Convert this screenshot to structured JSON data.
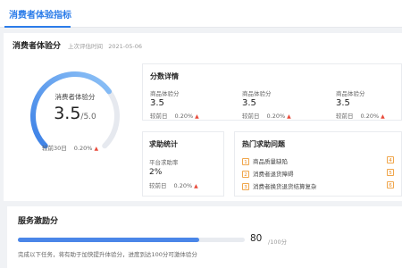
{
  "tab": {
    "label": "消费者体验指标"
  },
  "score_section": {
    "title": "消费者体验分",
    "time_label": "上次评估时间",
    "time_value": "2021-05-06",
    "gauge": {
      "label": "消费者体验分",
      "score": "3.5",
      "denominator": "/5.0",
      "score_value": 3.5,
      "max_value": 5.0,
      "compare_label": "较前30日",
      "compare_value": "0.20%"
    }
  },
  "detail_panel": {
    "title": "分数详情",
    "metrics": [
      {
        "label": "商品体验分",
        "value": "3.5",
        "compare_label": "较前日",
        "compare_value": "0.20%"
      },
      {
        "label": "商品体验分",
        "value": "3.5",
        "compare_label": "较前日",
        "compare_value": "0.20%"
      },
      {
        "label": "商品体验分",
        "value": "3.5",
        "compare_label": "较前日",
        "compare_value": "0.20%"
      }
    ]
  },
  "help_panel": {
    "title": "求助统计",
    "metric": {
      "label": "平台求助率",
      "value": "2%",
      "compare_label": "较前日",
      "compare_value": "0.20%"
    }
  },
  "hot_panel": {
    "title": "热门求助问题",
    "items": [
      {
        "num": "1",
        "text": "商品质量缺陷"
      },
      {
        "num": "2",
        "text": "消费者退货障碍"
      },
      {
        "num": "3",
        "text": "消费者换货退货结算复杂"
      }
    ],
    "more_nums": [
      "4",
      "5",
      "6"
    ]
  },
  "incentive": {
    "title": "服务激励分",
    "score": "80",
    "unit": "/100分",
    "progress": 0.8,
    "note": "完成以下任务，将有助于加快提升体验分，进度到达100分可激体验分"
  },
  "colors": {
    "accent": "#2b7ce9",
    "up": "#e84a3a",
    "badge": "#f0a64b"
  }
}
